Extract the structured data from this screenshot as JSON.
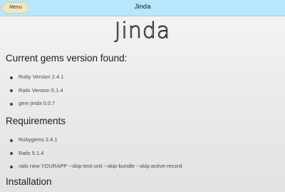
{
  "topbar": {
    "menu_label": "Menu",
    "title": "Jinda"
  },
  "logo": {
    "text": "Jinda"
  },
  "sections": {
    "current": {
      "title": "Current gems version found:",
      "items": [
        "Ruby Version 2.4.1",
        "Rails Version 5.1.4",
        "gem jinda 0.0.7"
      ]
    },
    "requirements": {
      "title": "Requirements",
      "items": [
        "Rubygems 2.4.1",
        "Rails 5.1.4",
        "rails new YOURAPP --skip-test-unit --skip-bundle --skip-active-record"
      ]
    },
    "installation": {
      "title": "Installation"
    }
  },
  "icons": {
    "bullet": "bullet-icon"
  }
}
